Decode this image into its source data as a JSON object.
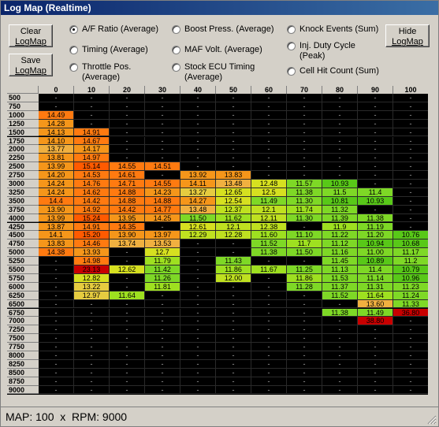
{
  "window": {
    "title": "Log Map (Realtime)"
  },
  "buttons": {
    "clear": [
      "Clear",
      "LogMap"
    ],
    "save": [
      "Save",
      "LogMap"
    ],
    "hide": [
      "Hide",
      "LogMap"
    ]
  },
  "modes": [
    {
      "id": "af-ratio",
      "label": "A/F Ratio (Average)",
      "selected": true
    },
    {
      "id": "timing",
      "label": "Timing (Average)",
      "selected": false
    },
    {
      "id": "throttle",
      "label": "Throttle Pos. (Average)",
      "selected": false
    },
    {
      "id": "boost",
      "label": "Boost Press. (Average)",
      "selected": false
    },
    {
      "id": "maf",
      "label": "MAF Volt. (Average)",
      "selected": false
    },
    {
      "id": "stock-timing",
      "label": "Stock ECU Timing (Average)",
      "selected": false
    },
    {
      "id": "knock",
      "label": "Knock Events (Sum)",
      "selected": false
    },
    {
      "id": "inj-duty",
      "label": "Inj. Duty Cycle (Peak)",
      "selected": false
    },
    {
      "id": "cell-hit",
      "label": "Cell Hit Count (Sum)",
      "selected": false
    }
  ],
  "table": {
    "columns": [
      "0",
      "10",
      "20",
      "30",
      "40",
      "50",
      "60",
      "70",
      "80",
      "90",
      "100"
    ],
    "rows": [
      "500",
      "750",
      "1000",
      "1250",
      "1500",
      "1750",
      "2000",
      "2250",
      "2500",
      "2750",
      "3000",
      "3250",
      "3500",
      "3750",
      "4000",
      "4250",
      "4500",
      "4750",
      "5000",
      "5250",
      "5500",
      "5750",
      "6000",
      "6250",
      "6500",
      "6750",
      "7000",
      "7250",
      "7500",
      "7750",
      "8000",
      "8250",
      "8500",
      "8750",
      "9000"
    ],
    "empty": "-",
    "cells": [
      [
        "-",
        "-",
        "-",
        "-",
        "-",
        "-",
        "-",
        "-",
        "-",
        "-",
        "-"
      ],
      [
        "-",
        "-",
        "-",
        "-",
        "-",
        "-",
        "-",
        "-",
        "-",
        "-",
        "-"
      ],
      [
        "14.49",
        "-",
        "-",
        "-",
        "-",
        "-",
        "-",
        "-",
        "-",
        "-",
        "-"
      ],
      [
        "14.28",
        "-",
        "-",
        "-",
        "-",
        "-",
        "-",
        "-",
        "-",
        "-",
        "-"
      ],
      [
        "14.13",
        "14.91",
        "-",
        "-",
        "-",
        "-",
        "-",
        "-",
        "-",
        "-",
        "-"
      ],
      [
        "14.10",
        "14.67",
        "-",
        "-",
        "-",
        "-",
        "-",
        "-",
        "-",
        "-",
        "-"
      ],
      [
        "13.77",
        "14.17",
        "-",
        "-",
        "-",
        "-",
        "-",
        "-",
        "-",
        "-",
        "-"
      ],
      [
        "13.81",
        "14.97",
        "-",
        "-",
        "-",
        "-",
        "-",
        "-",
        "-",
        "-",
        "-"
      ],
      [
        "13.99",
        "15.14",
        "14.55",
        "14.51",
        "-",
        "-",
        "-",
        "-",
        "-",
        "-",
        "-"
      ],
      [
        "14.20",
        "14.53",
        "14.61",
        "-",
        "13.92",
        "13.83",
        "-",
        "-",
        "-",
        "-",
        "-"
      ],
      [
        "14.24",
        "14.76",
        "14.71",
        "14.55",
        "14.11",
        "13.48",
        "12.48",
        "11.57",
        "10.93",
        "-",
        "-"
      ],
      [
        "14.24",
        "14.62",
        "14.88",
        "14.23",
        "13.27",
        "12.65",
        "12.5",
        "11.38",
        "11.5",
        "11.4",
        "-"
      ],
      [
        "14.4",
        "14.42",
        "14.88",
        "14.88",
        "14.27",
        "12.54",
        "11.49",
        "11.30",
        "10.81",
        "10.93",
        "-"
      ],
      [
        "13.90",
        "14.92",
        "14.42",
        "14.77",
        "13.48",
        "12.37",
        "12.1",
        "11.74",
        "11.32",
        "-",
        "-"
      ],
      [
        "13.99",
        "15.24",
        "13.95",
        "14.25",
        "11.50",
        "11.62",
        "12.11",
        "11.30",
        "11.39",
        "11.38",
        "-"
      ],
      [
        "13.87",
        "14.91",
        "14.35",
        "-",
        "12.61",
        "12.1",
        "12.38",
        "-",
        "11.9",
        "11.19",
        "-"
      ],
      [
        "14.1",
        "15.20",
        "13.90",
        "13.97",
        "12.29",
        "12.28",
        "11.60",
        "11.10",
        "11.22",
        "11.20",
        "10.76"
      ],
      [
        "13.83",
        "14.46",
        "13.74",
        "13.53",
        "-",
        "-",
        "11.52",
        "11.7",
        "11.12",
        "10.94",
        "10.68"
      ],
      [
        "14.38",
        "13.93",
        "-",
        "12.7",
        "-",
        "-",
        "11.38",
        "11.50",
        "11.16",
        "11.00",
        "11.17"
      ],
      [
        "-",
        "14.98",
        "-",
        "11.79",
        "-",
        "11.43",
        "-",
        "-",
        "11.45",
        "10.89",
        "11.2"
      ],
      [
        "-",
        "23.13",
        "12.62",
        "11.42",
        "-",
        "11.86",
        "11.67",
        "11.25",
        "11.13",
        "11.4",
        "10.79"
      ],
      [
        "-",
        "12.82",
        "-",
        "11.26",
        "-",
        "12.00",
        "-",
        "11.86",
        "11.53",
        "11.14",
        "10.96"
      ],
      [
        "-",
        "13.22",
        "-",
        "11.81",
        "-",
        "-",
        "-",
        "11.28",
        "11.37",
        "11.31",
        "11.23"
      ],
      [
        "-",
        "12.97",
        "11.64",
        "-",
        "-",
        "-",
        "-",
        "-",
        "11.52",
        "11.64",
        "11.24"
      ],
      [
        "-",
        "-",
        "-",
        "-",
        "-",
        "-",
        "-",
        "-",
        "-",
        "13.60",
        "11.33"
      ],
      [
        "-",
        "-",
        "-",
        "-",
        "-",
        "-",
        "-",
        "-",
        "11.38",
        "11.49",
        "36.80"
      ],
      [
        "-",
        "-",
        "-",
        "-",
        "-",
        "-",
        "-",
        "-",
        "-",
        "38.80",
        "-"
      ],
      [
        "-",
        "-",
        "-",
        "-",
        "-",
        "-",
        "-",
        "-",
        "-",
        "-",
        "-"
      ],
      [
        "-",
        "-",
        "-",
        "-",
        "-",
        "-",
        "-",
        "-",
        "-",
        "-",
        "-"
      ],
      [
        "-",
        "-",
        "-",
        "-",
        "-",
        "-",
        "-",
        "-",
        "-",
        "-",
        "-"
      ],
      [
        "-",
        "-",
        "-",
        "-",
        "-",
        "-",
        "-",
        "-",
        "-",
        "-",
        "-"
      ],
      [
        "-",
        "-",
        "-",
        "-",
        "-",
        "-",
        "-",
        "-",
        "-",
        "-",
        "-"
      ],
      [
        "-",
        "-",
        "-",
        "-",
        "-",
        "-",
        "-",
        "-",
        "-",
        "-",
        "-"
      ],
      [
        "-",
        "-",
        "-",
        "-",
        "-",
        "-",
        "-",
        "-",
        "-",
        "-",
        "-"
      ],
      [
        "-",
        "-",
        "-",
        "-",
        "-",
        "-",
        "-",
        "-",
        "-",
        "-",
        "-"
      ]
    ]
  },
  "status": {
    "text": "MAP: 100  x  RPM: 9000"
  },
  "icons": {
    "resize": "resize-grip-icon",
    "radio": "radio-button-icon"
  }
}
